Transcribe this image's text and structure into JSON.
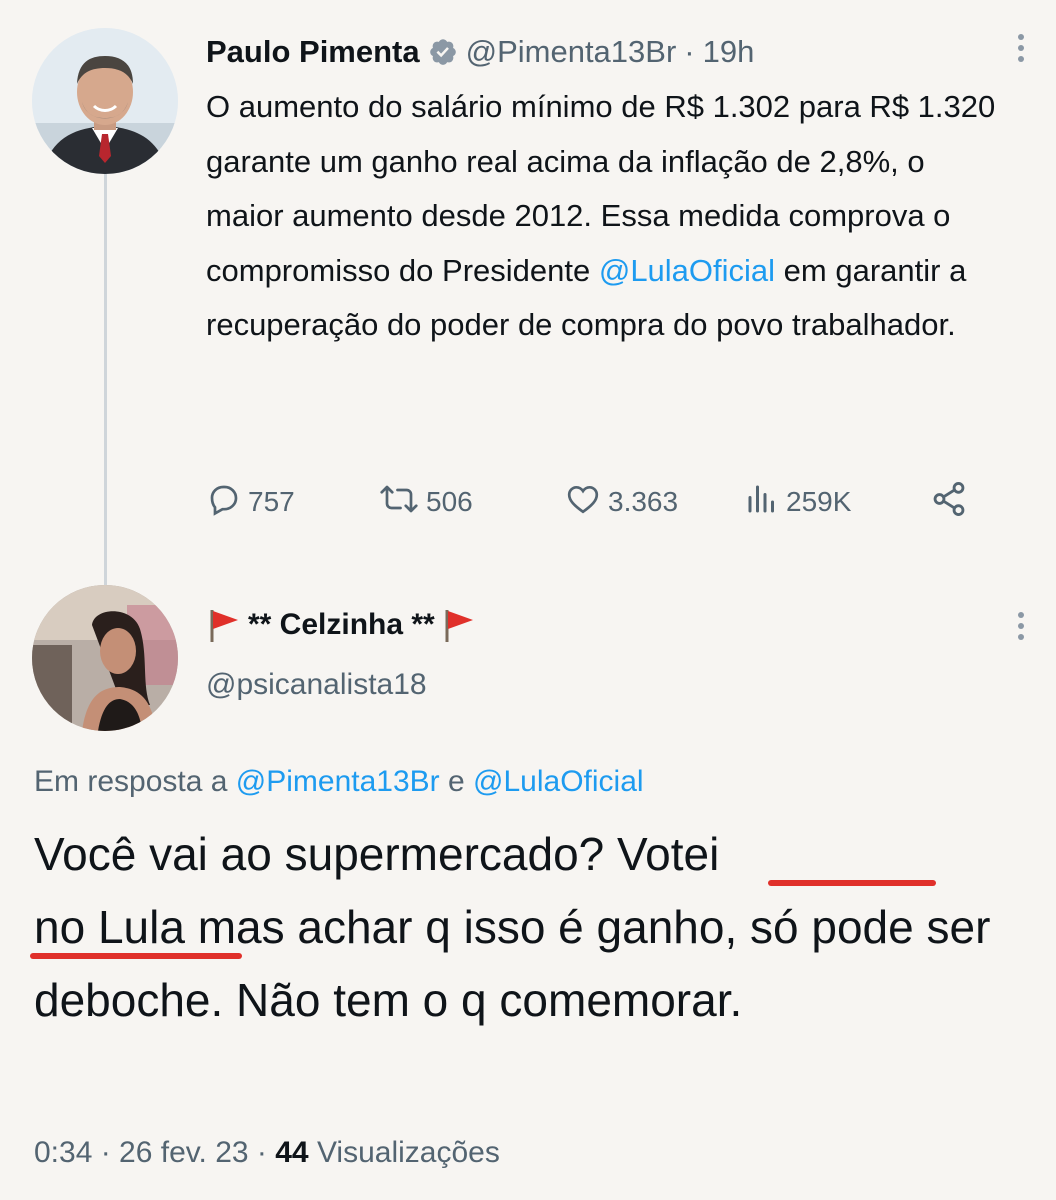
{
  "tweet": {
    "author_name": "Paulo Pimenta",
    "author_handle": "@Pimenta13Br",
    "separator": "·",
    "time": "19h",
    "text_before_mention": "O aumento do salário mínimo de R$ 1.302 para R$ 1.320 garante um ganho real acima da inflação de 2,8%, o maior aumento desde 2012. Essa medida comprova o compromisso do Presidente ",
    "mention": "@LulaOficial",
    "text_after_mention": " em garantir a recuperação do poder de compra do povo trabalhador.",
    "replies": "757",
    "retweets": "506",
    "likes": "3.363",
    "views": "259K"
  },
  "reply": {
    "author_name": "** Celzinha **",
    "author_handle": "@psicanalista18",
    "reply_prefix": "Em resposta a",
    "reply_mention_1": "@Pimenta13Br",
    "reply_conjunction": "e",
    "reply_mention_2": "@LulaOficial",
    "text_part1": "Você vai ao supermercado? ",
    "text_underlined_1": "Votei",
    "text_underlined_2": "no Lula",
    "text_part2": " mas achar q isso é  ganho, só pode ser deboche. Não tem o q comemorar.",
    "timestamp": "0:34 · 26 fev. 23 · ",
    "views_count": "44",
    "views_label": "Visualizações"
  },
  "icons": {
    "verified": "verified-badge-icon",
    "more": "more-icon",
    "reply": "reply-icon",
    "retweet": "retweet-icon",
    "like": "heart-icon",
    "views": "views-icon",
    "share": "share-icon",
    "flag": "red-flag-icon"
  },
  "colors": {
    "mention": "#1d9bf0",
    "secondary_text": "#536471",
    "underline": "#e0302a",
    "flag": "#e0302a"
  }
}
